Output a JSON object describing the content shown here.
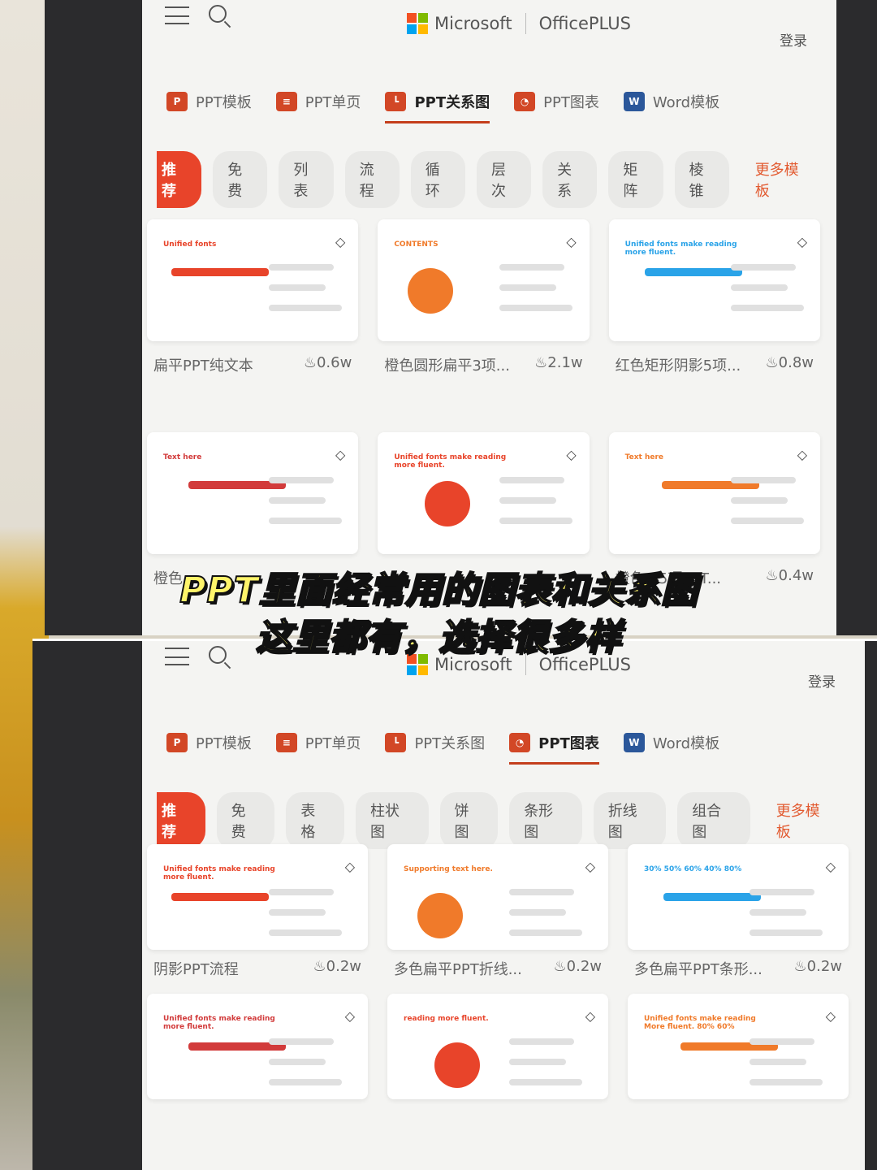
{
  "caption": {
    "line1": "PPT里面经常用的图表和关系图",
    "line2": "这里都有，选择很多样"
  },
  "brand": {
    "microsoft": "Microsoft",
    "product": "OfficePLUS",
    "login": "登录",
    "colors": [
      "#f25022",
      "#7fba00",
      "#00a4ef",
      "#ffb900"
    ]
  },
  "tabs": [
    {
      "label": "PPT模板",
      "icon": "ppt-icon",
      "color": "#d24726",
      "glyph": "P"
    },
    {
      "label": "PPT单页",
      "icon": "slide-icon",
      "color": "#d24726",
      "glyph": "≡"
    },
    {
      "label": "PPT关系图",
      "icon": "diagram-icon",
      "color": "#d24726",
      "glyph": "┗"
    },
    {
      "label": "PPT图表",
      "icon": "pie-chart-icon",
      "color": "#d24726",
      "glyph": "◔"
    },
    {
      "label": "Word模板",
      "icon": "word-icon",
      "color": "#2b579a",
      "glyph": "W"
    }
  ],
  "screen1": {
    "active_tab": 2,
    "chips": [
      "推荐",
      "免费",
      "列表",
      "流程",
      "循环",
      "层次",
      "关系",
      "矩阵",
      "棱锥"
    ],
    "more": "更多模板",
    "cards": [
      {
        "title": "扁平PPT纯文本",
        "views": "0.6w",
        "preview": "Unified fonts"
      },
      {
        "title": "橙色圆形扁平3项...",
        "views": "2.1w",
        "preview": "CONTENTS"
      },
      {
        "title": "红色矩形阴影5项...",
        "views": "0.8w",
        "preview": "Unified fonts make reading more fluent."
      },
      {
        "title": "橙色...",
        "views": "",
        "preview": "Text here"
      },
      {
        "title": "",
        "views": "",
        "preview": "Unified fonts make reading more fluent."
      },
      {
        "title": "橙色...5项PPT...",
        "views": "0.4w",
        "preview": "Text here"
      }
    ]
  },
  "screen2": {
    "active_tab": 3,
    "chips": [
      "推荐",
      "免费",
      "表格",
      "柱状图",
      "饼图",
      "条形图",
      "折线图",
      "组合图"
    ],
    "more": "更多模板",
    "cards": [
      {
        "title": "阴影PPT流程",
        "views": "0.2w",
        "preview": "Unified fonts make reading more fluent."
      },
      {
        "title": "多色扁平PPT折线...",
        "views": "0.2w",
        "preview": "Supporting text here."
      },
      {
        "title": "多色扁平PPT条形...",
        "views": "0.2w",
        "preview": "30% 50% 60% 40% 80%"
      },
      {
        "title": "",
        "views": "",
        "preview": "Unified fonts make reading more fluent."
      },
      {
        "title": "",
        "views": "",
        "preview": "reading more fluent."
      },
      {
        "title": "",
        "views": "",
        "preview": "Unified fonts make reading More fluent. 80% 60%"
      }
    ]
  }
}
